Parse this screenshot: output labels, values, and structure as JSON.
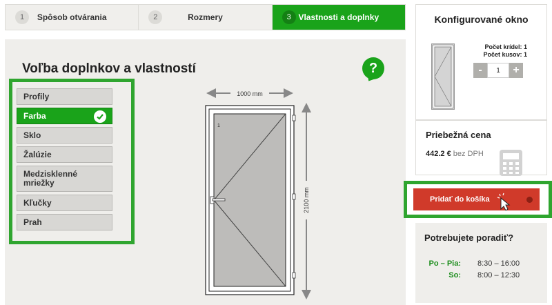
{
  "steps": [
    {
      "num": "1",
      "label": "Spôsob otvárania"
    },
    {
      "num": "2",
      "label": "Rozmery"
    },
    {
      "num": "3",
      "label": "Vlastnosti a doplnky"
    }
  ],
  "main": {
    "title": "Voľba doplnkov a vlastností",
    "help_label": "?",
    "menu": [
      {
        "label": "Profily"
      },
      {
        "label": "Farba"
      },
      {
        "label": "Sklo"
      },
      {
        "label": "Žalúzie"
      },
      {
        "label": "Medzisklenné mriežky"
      },
      {
        "label": "Kľučky"
      },
      {
        "label": "Prah"
      }
    ],
    "width_label": "1000 mm",
    "height_label": "2100 mm",
    "sash_number": "1"
  },
  "sidebar": {
    "config_title": "Konfigurované okno",
    "wings_label": "Počet krídel: 1",
    "count_label": "Počet kusov: 1",
    "qty_minus": "-",
    "qty_value": "1",
    "qty_plus": "+",
    "price_title": "Priebežná cena",
    "price_value": "442.2 €",
    "price_vat": "bez DPH",
    "cart_label": "Pridať do košíka",
    "help_title": "Potrebujete poradiť?",
    "hours": [
      {
        "day": "Po – Pia:",
        "time": "8:30 – 16:00"
      },
      {
        "day": "So:",
        "time": "8:00 – 12:30"
      }
    ]
  },
  "colors": {
    "accent_green": "#1aa31a",
    "cart_red": "#d03a2a",
    "highlight_green": "#2fa52f"
  }
}
